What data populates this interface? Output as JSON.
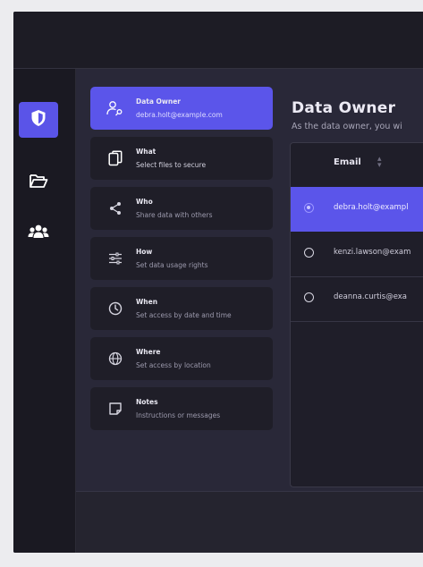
{
  "main": {
    "title": "Data Owner",
    "subtitle": "As the data owner, you wi"
  },
  "rail": {
    "items": [
      {
        "icon": "shield-icon",
        "active": true
      },
      {
        "icon": "folder-open-icon",
        "active": false
      },
      {
        "icon": "users-icon",
        "active": false
      }
    ]
  },
  "steps": [
    {
      "title": "Data Owner",
      "subtitle": "debra.holt@example.com",
      "icon": "user-key-icon",
      "active": true
    },
    {
      "title": "What",
      "subtitle": "Select files to secure",
      "icon": "copy-files-icon"
    },
    {
      "title": "Who",
      "subtitle": "Share data with others",
      "icon": "share-icon"
    },
    {
      "title": "How",
      "subtitle": "Set data usage rights",
      "icon": "sliders-icon"
    },
    {
      "title": "When",
      "subtitle": "Set access by date and time",
      "icon": "clock-icon"
    },
    {
      "title": "Where",
      "subtitle": "Set access by location",
      "icon": "globe-icon"
    },
    {
      "title": "Notes",
      "subtitle": "Instructions or messages",
      "icon": "note-icon"
    }
  ],
  "table": {
    "header_email": "Email",
    "rows": [
      {
        "email": "debra.holt@exampl",
        "selected": true
      },
      {
        "email": "kenzi.lawson@exam",
        "selected": false
      },
      {
        "email": "deanna.curtis@exa",
        "selected": false
      }
    ]
  },
  "colors": {
    "accent": "#5b55ea",
    "background": "#292838",
    "panel": "#1f1e28"
  }
}
